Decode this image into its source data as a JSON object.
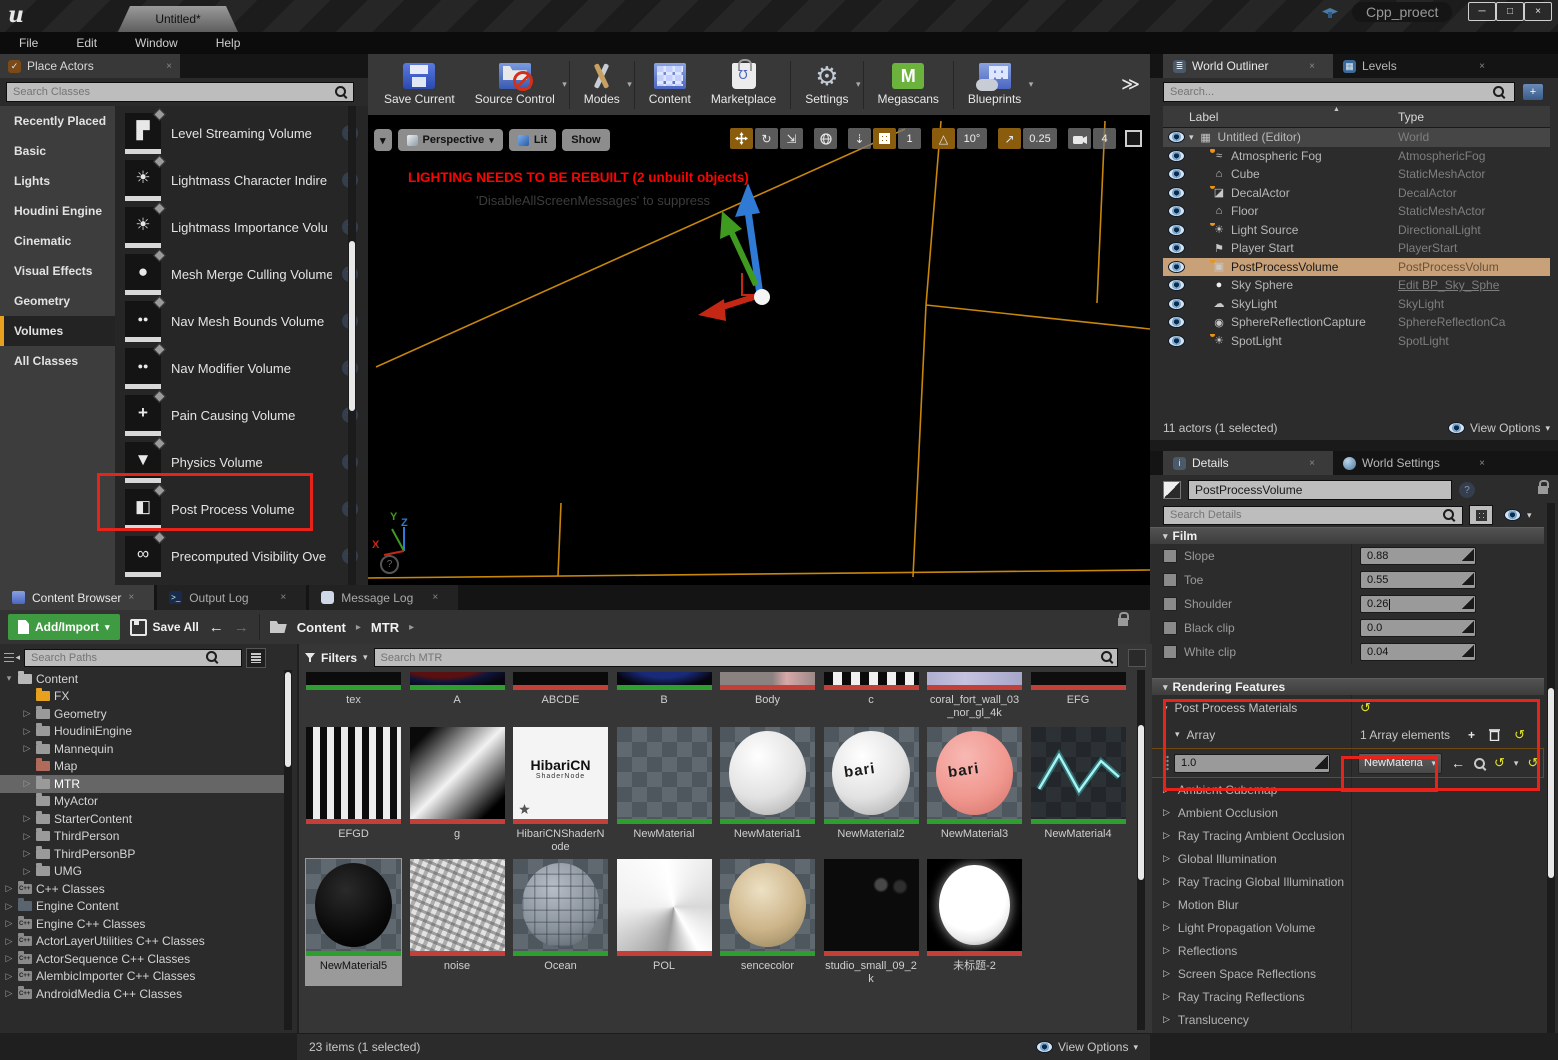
{
  "window": {
    "doc_tab": "Untitled*",
    "project_badge": "Cpp_proect"
  },
  "menu": {
    "items": [
      "File",
      "Edit",
      "Window",
      "Help"
    ]
  },
  "icons_glyphs": {
    "caret_down": "▾",
    "tri_right": "▷",
    "tri_down": "▾",
    "breadcrumb_sep": "▸",
    "back": "←",
    "forward": "→",
    "reset": "↺",
    "add": "+",
    "chevrons": "≫",
    "sort_asc": "▲",
    "question": "?",
    "close": "×",
    "minimize": "─",
    "maximize": "□",
    "levels": "▦",
    "fog": "≈",
    "house": "⌂",
    "decal": "◪",
    "sun": "☀",
    "player_start": "⚑",
    "postprocess": "▣",
    "sphere": "●",
    "cloud": "☁",
    "reflection": "◉",
    "quad": "▛",
    "dots": "●●",
    "plus": "+",
    "weight": "▼",
    "half_square": "◧",
    "infinity": "∞",
    "angle": "△",
    "ne_arrow": "↗",
    "down_arrow": "⇣",
    "rotate": "↻",
    "scale": "⇲",
    "filter_menu": "≡"
  },
  "place_actors": {
    "tab_label": "Place Actors",
    "search_placeholder": "Search Classes",
    "categories": [
      "Recently Placed",
      "Basic",
      "Lights",
      "Houdini Engine",
      "Cinematic",
      "Visual Effects",
      "Geometry",
      "Volumes",
      "All Classes"
    ],
    "items": [
      "Level Streaming Volume",
      "Lightmass Character Indire",
      "Lightmass Importance Volu",
      "Mesh Merge Culling Volume",
      "Nav Mesh Bounds Volume",
      "Nav Modifier Volume",
      "Pain Causing Volume",
      "Physics Volume",
      "Post Process Volume",
      "Precomputed Visibility Ove"
    ]
  },
  "main_toolbar": {
    "buttons": [
      "Save Current",
      "Source Control",
      "Modes",
      "Content",
      "Marketplace",
      "Settings",
      "Megascans",
      "Blueprints"
    ]
  },
  "viewport": {
    "perspective_label": "Perspective",
    "lit_label": "Lit",
    "show_label": "Show",
    "warning_text": "LIGHTING NEEDS TO BE REBUILT (2 unbuilt objects)",
    "suppress_hint": "'DisableAllScreenMessages' to suppress",
    "grid_snap_value": "1",
    "angle_snap_value": "10°",
    "scale_snap_value": "0.25",
    "camera_speed_value": "4",
    "axis_x": "X",
    "axis_y": "Y",
    "axis_z": "Z"
  },
  "outliner": {
    "tab_world_outliner": "World Outliner",
    "tab_levels": "Levels",
    "search_placeholder": "Search...",
    "col_label": "Label",
    "col_type": "Type",
    "rows": [
      {
        "label": "Untitled (Editor)",
        "type": "World",
        "icon": "levels-icon"
      },
      {
        "label": "Atmospheric Fog",
        "type": "AtmosphericFog",
        "icon": "fog-icon"
      },
      {
        "label": "Cube",
        "type": "StaticMeshActor",
        "icon": "house-icon"
      },
      {
        "label": "DecalActor",
        "type": "DecalActor",
        "icon": "decal-icon"
      },
      {
        "label": "Floor",
        "type": "StaticMeshActor",
        "icon": "house-icon"
      },
      {
        "label": "Light Source",
        "type": "DirectionalLight",
        "icon": "sun-icon"
      },
      {
        "label": "Player Start",
        "type": "PlayerStart",
        "icon": "player-start-icon"
      },
      {
        "label": "PostProcessVolume",
        "type": "PostProcessVolum",
        "icon": "postprocess-icon",
        "selected": true
      },
      {
        "label": "Sky Sphere",
        "type": "Edit BP_Sky_Sphe",
        "icon": "sphere-icon",
        "link": true
      },
      {
        "label": "SkyLight",
        "type": "SkyLight",
        "icon": "cloud-icon"
      },
      {
        "label": "SphereReflectionCapture",
        "type": "SphereReflectionCa",
        "icon": "reflection-icon"
      },
      {
        "label": "SpotLight",
        "type": "SpotLight",
        "icon": "sun-icon"
      }
    ],
    "footer_status": "11 actors (1 selected)",
    "view_options_label": "View Options"
  },
  "details": {
    "tab_details": "Details",
    "tab_world_settings": "World Settings",
    "name_value": "PostProcessVolume",
    "search_placeholder": "Search Details",
    "film_section": "Film",
    "film_rows": [
      {
        "label": "Slope",
        "value": "0.88"
      },
      {
        "label": "Toe",
        "value": "0.55"
      },
      {
        "label": "Shoulder",
        "value": "0.26"
      },
      {
        "label": "Black clip",
        "value": "0.0"
      },
      {
        "label": "White clip",
        "value": "0.04"
      }
    ],
    "rendering_features_section": "Rendering Features",
    "post_process_materials_label": "Post Process Materials",
    "array_label": "Array",
    "array_count": "1 Array elements",
    "element_weight": "1.0",
    "element_material": "NewMateria",
    "collapsed_sections": [
      "Ambient Cubemap",
      "Ambient Occlusion",
      "Ray Tracing Ambient Occlusion",
      "Global Illumination",
      "Ray Tracing Global Illumination",
      "Motion Blur",
      "Light Propagation Volume",
      "Reflections",
      "Screen Space Reflections",
      "Ray Tracing Reflections",
      "Translucency"
    ]
  },
  "content_browser": {
    "tabs": [
      "Content Browser",
      "Output Log",
      "Message Log"
    ],
    "add_import_label": "Add/Import",
    "save_all_label": "Save All",
    "breadcrumb_root": "Content",
    "breadcrumb_current": "MTR",
    "search_paths_placeholder": "Search Paths",
    "filters_label": "Filters",
    "search_assets_placeholder": "Search MTR",
    "tree": [
      "Content",
      "FX",
      "Geometry",
      "HoudiniEngine",
      "Mannequin",
      "Map",
      "MTR",
      "MyActor",
      "StarterContent",
      "ThirdPerson",
      "ThirdPersonBP",
      "UMG",
      "C++ Classes",
      "Engine Content",
      "Engine C++ Classes",
      "ActorLayerUtilities C++ Classes",
      "ActorSequence C++ Classes",
      "AlembicImporter C++ Classes",
      "AndroidMedia C++ Classes"
    ],
    "assets": [
      {
        "name": "tex"
      },
      {
        "name": "A"
      },
      {
        "name": "ABCDE"
      },
      {
        "name": "B"
      },
      {
        "name": "Body"
      },
      {
        "name": "c"
      },
      {
        "name": "coral_fort_wall_03_nor_gl_4k"
      },
      {
        "name": "EFG"
      },
      {
        "name": "EFGD"
      },
      {
        "name": "g"
      },
      {
        "name": "HibariCNShaderNode"
      },
      {
        "name": "NewMaterial"
      },
      {
        "name": "NewMaterial1"
      },
      {
        "name": "NewMaterial2"
      },
      {
        "name": "NewMaterial3"
      },
      {
        "name": "NewMaterial4"
      },
      {
        "name": "NewMaterial5"
      },
      {
        "name": "noise"
      },
      {
        "name": "Ocean"
      },
      {
        "name": "POL"
      },
      {
        "name": "sencecolor"
      },
      {
        "name": "studio_small_09_2k"
      },
      {
        "name": "未标题-2"
      }
    ],
    "hibari_thumb_title": "HibariCN",
    "hibari_thumb_sub": "ShaderNode",
    "sphere_overlay_text": "bari",
    "status": "23 items (1 selected)",
    "view_options_label": "View Options"
  },
  "colors": {
    "selection_tan": "#c9a178",
    "annotation_red": "#e8231a",
    "add_import_green": "#3f9b41",
    "megascans_green": "#6cb33e",
    "folder_orange": "#e8a11f",
    "folder_red": "#b26a5a",
    "link_blue": "#6aa7e0",
    "warning_red": "#fb0300",
    "reset_yellow": "#e3e32a",
    "snap_active_orange": "#8a5c0e",
    "wireframe_orange": "#c8860a"
  }
}
